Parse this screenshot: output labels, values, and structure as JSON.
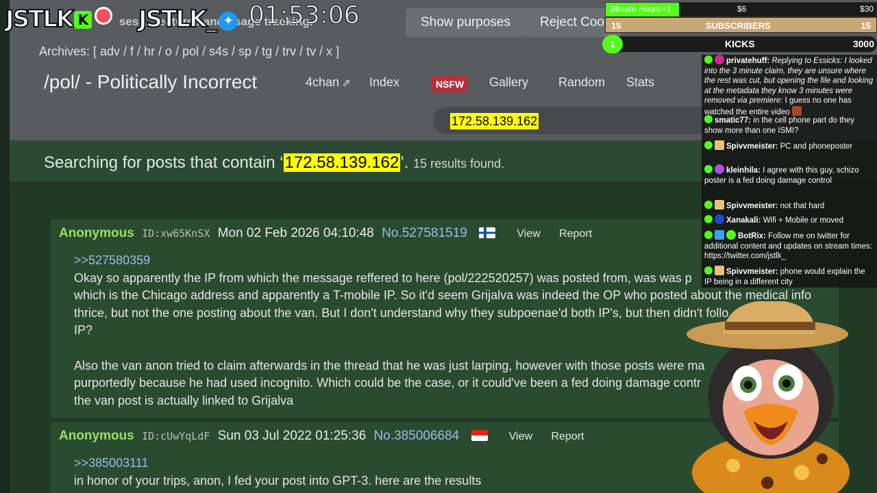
{
  "site": {
    "cookie_text": "ses ... features and usage tracking.",
    "show_purposes": "Show purposes",
    "reject_cookies": "Reject Cook",
    "archives": "Archives: [ adv / f / hr / o / pol / s4s / sp / tg / trv / tv / x ]",
    "board_title": "/pol/ - Politically Incorrect",
    "nav": {
      "fourchan": "4chan",
      "index": "Index",
      "nsfw": "NSFW",
      "gallery": "Gallery",
      "random": "Random",
      "stats": "Stats"
    },
    "search_value": "172.58.139.162"
  },
  "results": {
    "prefix": "Searching for posts that contain ‘",
    "query": "172.58.139.162",
    "suffix": "’.",
    "count": "15 results found."
  },
  "posts": [
    {
      "name": "Anonymous",
      "id": "ID:xw65KnSX",
      "date": "Mon 02 Feb 2026 04:10:48",
      "no": "No.527581519",
      "view": "View",
      "report": "Report",
      "quote": ">>527580359",
      "lines": [
        "Okay so apparently the IP from which the message reffered to here (pol/222520257) was posted from, was was p",
        "which is the Chicago address and apparently a T-mobile IP. So it'd seem Grijalva was indeed the OP who posted about the medical info",
        "thrice, but not the one posting about the van. But I don't understand why they subpoenae'd both IP's, but then didn't follo",
        "IP?",
        "",
        "Also the van anon tried to claim afterwards in the thread that he was just larping, however with those posts were ma",
        "purportedly because he had used incognito. Which could be the case, or it could've been a fed doing damage contr",
        "the van post is actually linked to Grijalva"
      ]
    },
    {
      "name": "Anonymous",
      "id": "ID:cUwYqLdF",
      "date": "Sun 03 Jul 2022 01:25:36",
      "no": "No.385006684",
      "view": "View",
      "report": "Report",
      "quote": ">>385003111",
      "lines": [
        "in honor of your trips, anon, I fed your post into GPT-3. here are the results"
      ]
    }
  ],
  "overlay": {
    "logo_left": "JSTLK",
    "kick_badge": "K",
    "logo_right": "JSTLK_",
    "timer": "01:53:06",
    "goal_stream_hours": {
      "label": "Stream Hours",
      "plus": "+1",
      "mid": "$6",
      "max": "$30",
      "progress": 0.27
    },
    "goal_subscribers": {
      "left": "15",
      "label": "SUBSCRIBERS",
      "right": "15"
    },
    "goal_kicks": {
      "left": "1",
      "label": "KICKS",
      "right": "3000"
    }
  },
  "chat": [
    {
      "user": "privatehuff:",
      "text": "Replying to Essicks: I looked into the 3 minute claim, they are unsure where the rest was cut, but opening the file and looking at the metadata they know 3 minutes were removed via premiere:",
      "text2": "I guess no one has watched the entire video",
      "avatar": "#d0288f"
    },
    {
      "user": "smatic77:",
      "text": "in the cell phone part do they show more than one ISMI?",
      "avatar": ""
    },
    {
      "user": "Spivvmeister:",
      "text": "PC and phoneposter",
      "avatar": ""
    },
    {
      "user": "kleinhila:",
      "text": "I agree with this guy, schizo poster is a fed doing damage control",
      "avatar": "#b04ee0"
    },
    {
      "user": "Spivvmeister:",
      "text": "not that hard",
      "avatar": ""
    },
    {
      "user": "Xanakali:",
      "text": "Wifi + Mobile or moved",
      "avatar": "#2244dd"
    },
    {
      "user": "BotRix:",
      "text": "Follow me on twitter for additional content and updates on stream times: https://twitter.com/jstlk_",
      "avatar": ""
    },
    {
      "user": "Spivvmeister:",
      "text": "phone would explain the IP being in a different city",
      "avatar": ""
    }
  ],
  "colors": {
    "header_bg": "#585c5f",
    "result_bg": "#2c4a33",
    "post_bg": "#2a4b30",
    "name_green": "#9adf6a",
    "link_blue": "#9dbde6",
    "highlight": "#ffff00",
    "kick_green": "#53fc18"
  }
}
